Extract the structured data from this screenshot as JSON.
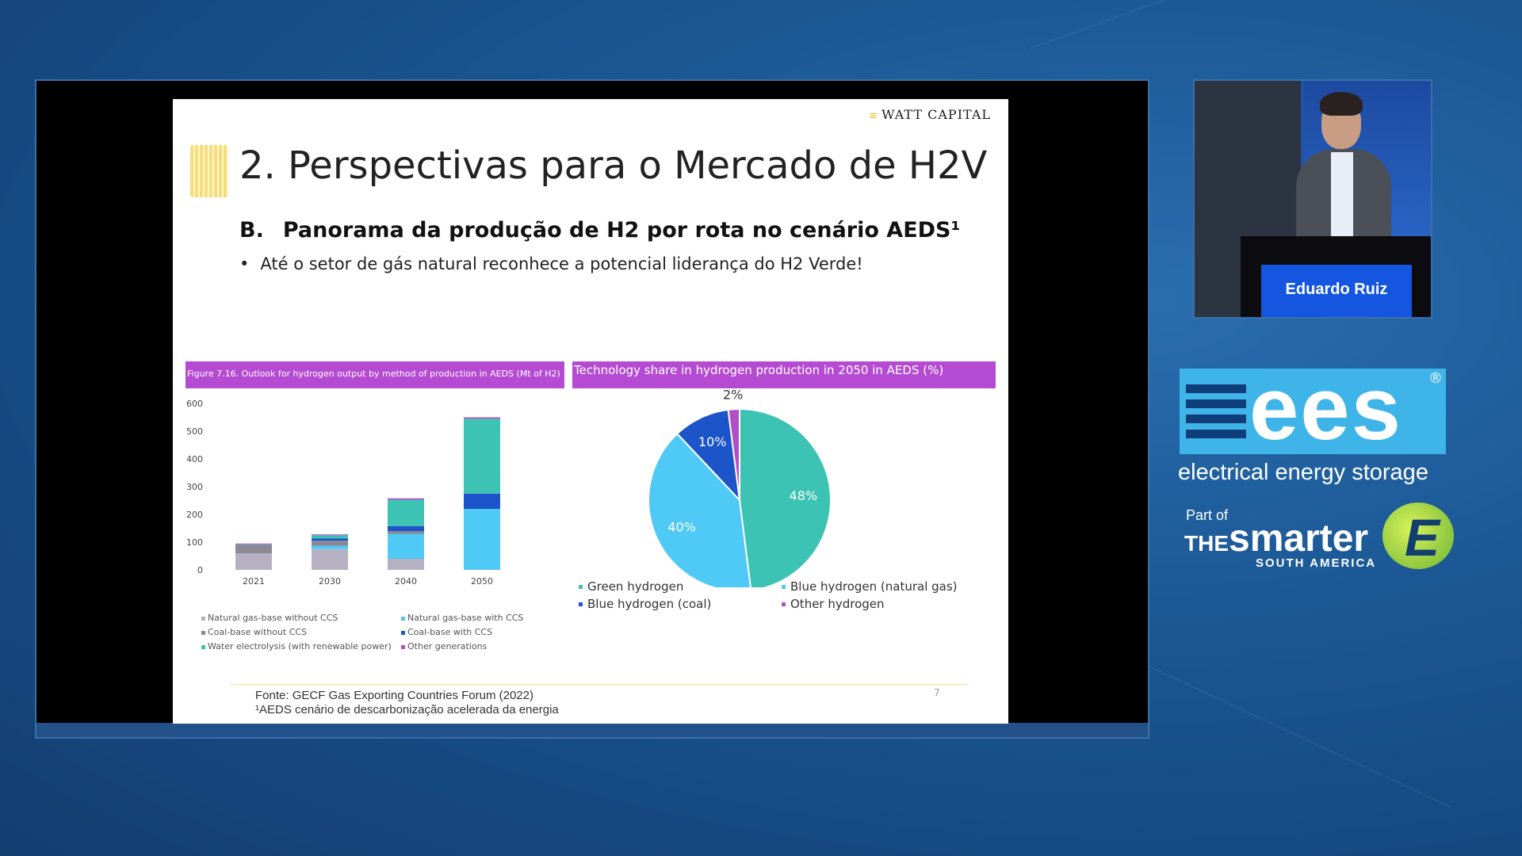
{
  "slide": {
    "logo": "WATT CAPITAL",
    "title": "2. Perspectivas para o Mercado de H2V",
    "subtitle_num": "B.",
    "subtitle": "Panorama da produção de H2 por rota no cenário AEDS¹",
    "bullet": "Até o setor de gás natural reconhece a potencial liderança do H2 Verde!",
    "bar_header": "Figure 7.16. Outlook for hydrogen output by method of production in AEDS (Mt of H2)",
    "pie_header": "Technology share in hydrogen production in 2050 in AEDS (%)",
    "source_line1": "Fonte: GECF    Gas Exporting Countries Forum (2022)",
    "source_line2": "¹AEDS    cenário de descarbonização acelerada da energia",
    "page_number": "7"
  },
  "bar_legend": [
    {
      "label": "Natural gas-base without CCS",
      "color": "#b6b1c2"
    },
    {
      "label": "Natural gas-base with CCS",
      "color": "#4fcaf6"
    },
    {
      "label": "Coal-base without CCS",
      "color": "#8c8896"
    },
    {
      "label": "Coal-base with CCS",
      "color": "#1b55c9"
    },
    {
      "label": "Water electrolysis (with renewable power)",
      "color": "#3cc3b3"
    },
    {
      "label": "Other generations",
      "color": "#b24fc6"
    }
  ],
  "pie_legend": [
    {
      "label": "Green hydrogen",
      "color": "#3cc3b3"
    },
    {
      "label": "Blue hydrogen (natural gas)",
      "color": "#4fcaf6"
    },
    {
      "label": "Blue hydrogen (coal)",
      "color": "#1b55c9"
    },
    {
      "label": "Other hydrogen",
      "color": "#b24fc6"
    }
  ],
  "speaker": {
    "name": "Eduardo Ruiz"
  },
  "branding": {
    "ees": "ees",
    "reg": "®",
    "tagline": "electrical energy storage",
    "part_of": "Part of",
    "the": "THE",
    "smarter": "smarter",
    "south_america": "SOUTH AMERICA",
    "e_mark": "E"
  },
  "chart_data": [
    {
      "type": "bar",
      "stacked": true,
      "title": "Figure 7.16. Outlook for hydrogen output by method of production in AEDS (Mt of H2)",
      "categories": [
        "2021",
        "2030",
        "2040",
        "2050"
      ],
      "ylim": [
        0,
        600
      ],
      "yticks": [
        0,
        100,
        200,
        300,
        400,
        500,
        600
      ],
      "grid": false,
      "series": [
        {
          "name": "Natural gas-base without CCS",
          "color": "#b6b1c2",
          "values": [
            60,
            75,
            40,
            0
          ]
        },
        {
          "name": "Natural gas-base with CCS",
          "color": "#4fcaf6",
          "values": [
            0,
            12,
            90,
            220
          ]
        },
        {
          "name": "Coal-base without CCS",
          "color": "#8c8896",
          "values": [
            30,
            18,
            10,
            0
          ]
        },
        {
          "name": "Coal-base with CCS",
          "color": "#1b55c9",
          "values": [
            0,
            8,
            18,
            55
          ]
        },
        {
          "name": "Water electrolysis (with renewable power)",
          "color": "#3cc3b3",
          "values": [
            2,
            12,
            95,
            270
          ]
        },
        {
          "name": "Other generations",
          "color": "#b24fc6",
          "values": [
            3,
            3,
            5,
            5
          ]
        }
      ]
    },
    {
      "type": "pie",
      "title": "Technology share in hydrogen production in 2050 in AEDS (%)",
      "slices": [
        {
          "name": "Green hydrogen",
          "value": 48,
          "label": "48%",
          "color": "#3cc3b3"
        },
        {
          "name": "Blue hydrogen (natural gas)",
          "value": 40,
          "label": "40%",
          "color": "#4fcaf6"
        },
        {
          "name": "Blue hydrogen (coal)",
          "value": 10,
          "label": "10%",
          "color": "#1b55c9"
        },
        {
          "name": "Other hydrogen",
          "value": 2,
          "label": "2%",
          "color": "#b24fc6"
        }
      ],
      "legend": "bottom"
    }
  ]
}
